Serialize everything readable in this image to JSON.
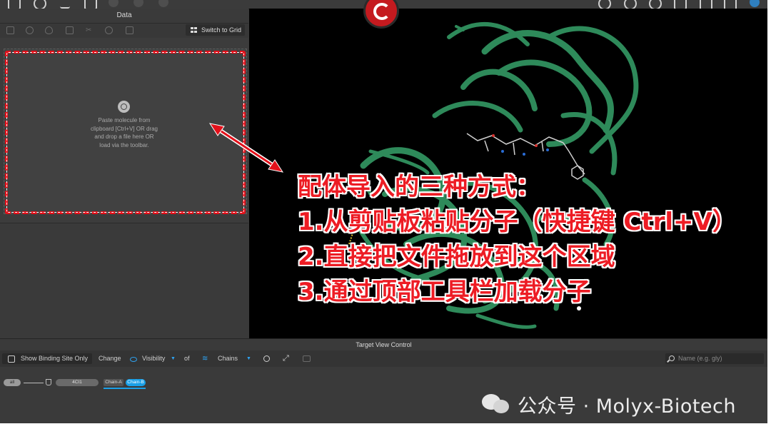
{
  "data_panel": {
    "title": "Data",
    "switch_label": "Switch to Grid",
    "drop_lines": [
      "Paste molecule from",
      "clipboard [Ctrl+V] OR drag",
      "and drop a file here OR",
      "load via the toolbar."
    ]
  },
  "callout": {
    "lines": [
      "配体导入的三种方式：",
      "1.从剪贴板粘贴分子（快捷键 Ctrl+V）",
      "2.直接把文件拖放到这个区域",
      "3.通过顶部工具栏加载分子"
    ]
  },
  "target_control": {
    "title": "Target View Control",
    "show_binding_label": "Show Binding Site Only",
    "change_label": "Change",
    "visibility_label": "Visibility",
    "of_label": "of",
    "chains_label": "Chains",
    "name_placeholder": "Name (e.g. gly)"
  },
  "chains": {
    "all_label": "all",
    "pdb_label": "4CI1",
    "items": [
      "Chain-A",
      "Chain-B"
    ]
  },
  "watermark": "公众号 · Molyx-Biotech",
  "colors": {
    "protein": "#2e8a5a",
    "annotation_red": "#e3101a",
    "accent_blue": "#1aa0e8"
  }
}
